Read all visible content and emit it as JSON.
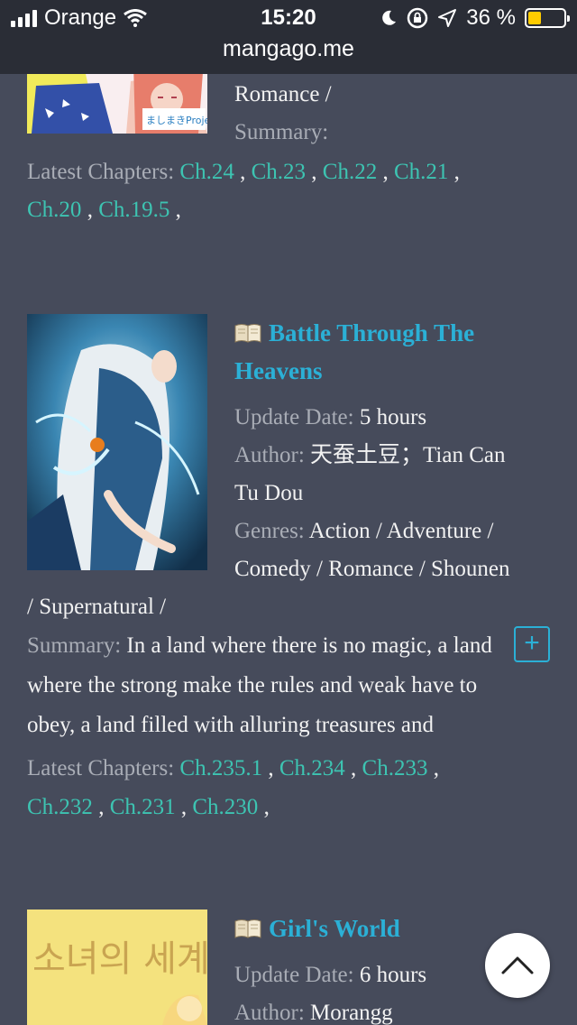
{
  "status_bar": {
    "carrier": "Orange",
    "time": "15:20",
    "battery": "36 %",
    "battery_level": 0.36,
    "url": "mangago.me"
  },
  "entry_previous": {
    "genres_tail": "Romance /",
    "summary_label": "Summary:",
    "latest_label": "Latest Chapters:",
    "chapters": [
      "Ch.24",
      "Ch.23",
      "Ch.22",
      "Ch.21",
      "Ch.20",
      "Ch.19.5"
    ]
  },
  "entry_btth": {
    "title_line1": "Battle Through The",
    "title_line2": "Heavens",
    "update_label": "Update Date:",
    "update_value": "5 hours",
    "author_label": "Author:",
    "author_value_1": "天蚕土豆；Tian Can",
    "author_value_2": "Tu Dou",
    "genres_label": "Genres:",
    "genres_line1": "Action / Adventure /",
    "genres_line2": "Comedy / Romance / Shounen",
    "genres_line3": "/ Supernatural /",
    "summary_label": "Summary:",
    "summary_line1": "In a land where there is no magic, a land",
    "summary_line2": "where the strong make the rules and weak have to",
    "summary_line3": "obey, a land filled with alluring treasures and",
    "latest_label": "Latest Chapters:",
    "chapters": [
      "Ch.235.1",
      "Ch.234",
      "Ch.233",
      "Ch.232",
      "Ch.231",
      "Ch.230"
    ]
  },
  "entry_girls_world": {
    "title": "Girl's World",
    "cover_text": "소녀의 세계",
    "update_label": "Update Date:",
    "update_value": "6 hours",
    "author_label": "Author:",
    "author_value": "Morangg"
  },
  "colors": {
    "background": "#464b5b",
    "title": "#2bb0d6",
    "chapter_link": "#3dc4b2",
    "label": "#a9adb6"
  }
}
